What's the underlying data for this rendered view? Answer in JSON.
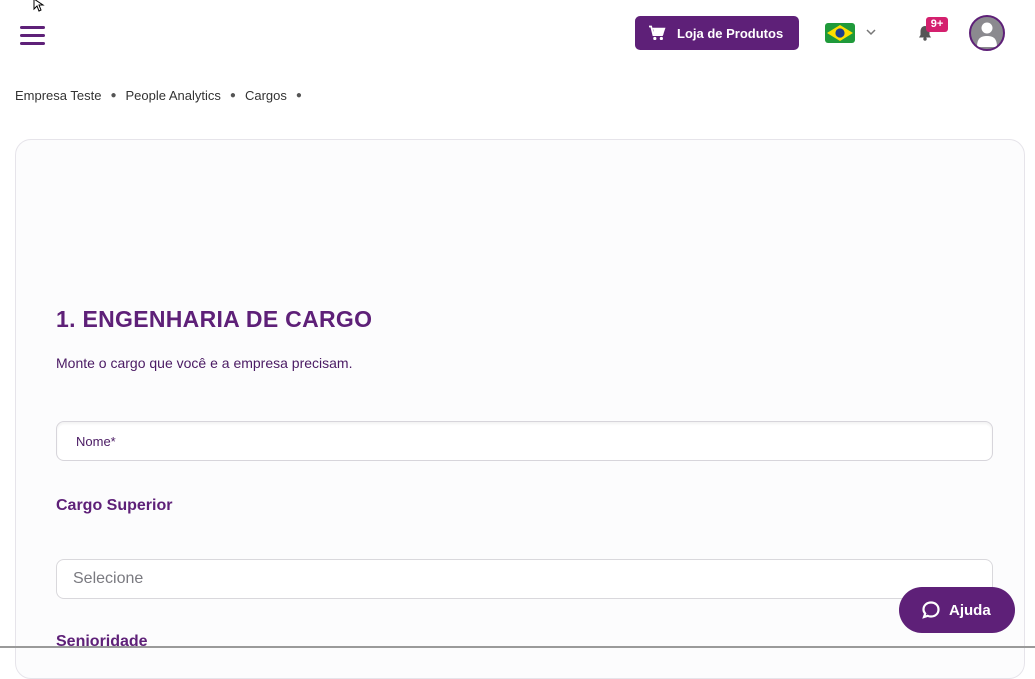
{
  "header": {
    "shop_button_label": "Loja de Produtos",
    "notification_count": "9+",
    "flag": "brazil-flag"
  },
  "breadcrumb": {
    "items": [
      "Empresa Teste",
      "People Analytics",
      "Cargos"
    ]
  },
  "form": {
    "section_title": "1. ENGENHARIA DE CARGO",
    "section_description": "Monte o cargo que você e a empresa precisam.",
    "name_placeholder": "Nome*",
    "cargo_superior_label": "Cargo Superior",
    "cargo_superior_placeholder": "Selecione",
    "senioridade_label": "Senioridade"
  },
  "help": {
    "label": "Ajuda"
  },
  "colors": {
    "brand": "#5e2078",
    "badge": "#d4206e"
  }
}
